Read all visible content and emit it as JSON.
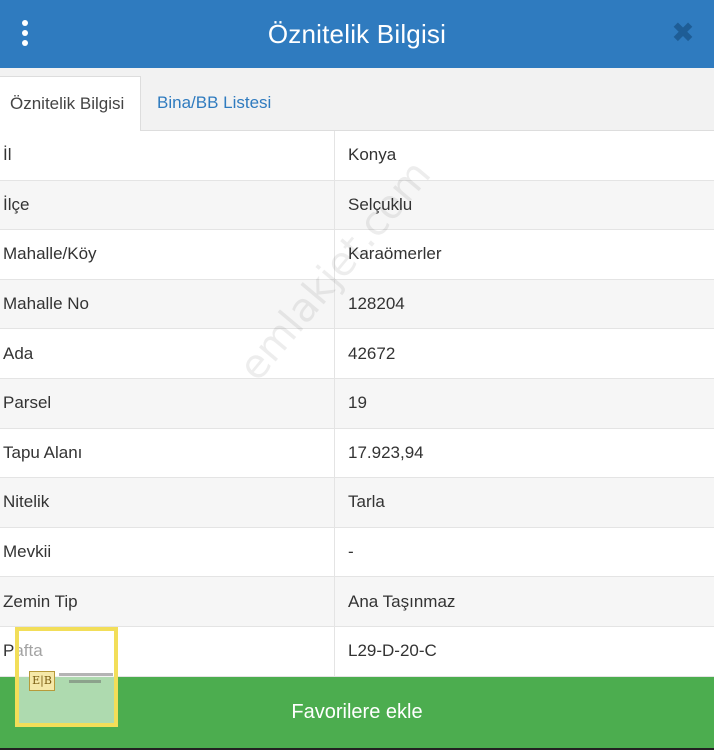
{
  "header": {
    "title": "Öznitelik Bilgisi",
    "close_symbol": "✖",
    "menu_icon": "kebab-menu-icon"
  },
  "tabs": [
    {
      "label": "Öznitelik Bilgisi",
      "active": true
    },
    {
      "label": "Bina/BB Listesi",
      "active": false
    }
  ],
  "attributes": [
    {
      "label": "İl",
      "value": "Konya"
    },
    {
      "label": "İlçe",
      "value": "Selçuklu"
    },
    {
      "label": "Mahalle/Köy",
      "value": "Karaömerler"
    },
    {
      "label": "Mahalle No",
      "value": "128204"
    },
    {
      "label": "Ada",
      "value": "42672"
    },
    {
      "label": "Parsel",
      "value": "19"
    },
    {
      "label": "Tapu Alanı",
      "value": "17.923,94"
    },
    {
      "label": "Nitelik",
      "value": "Tarla"
    },
    {
      "label": "Mevkii",
      "value": "-"
    },
    {
      "label": "Zemin Tip",
      "value": "Ana Taşınmaz"
    },
    {
      "label": "Pafta",
      "value": "L29-D-20-C"
    }
  ],
  "watermark": "emlakjet.com",
  "logo": {
    "letters": "E|B"
  },
  "footer": {
    "favorite_button_label": "Favorilere ekle"
  },
  "colors": {
    "header_bg": "#2f7bbf",
    "tab_link": "#2f7bbf",
    "button_bg": "#4cad4f",
    "logo_border": "#f2de59"
  }
}
